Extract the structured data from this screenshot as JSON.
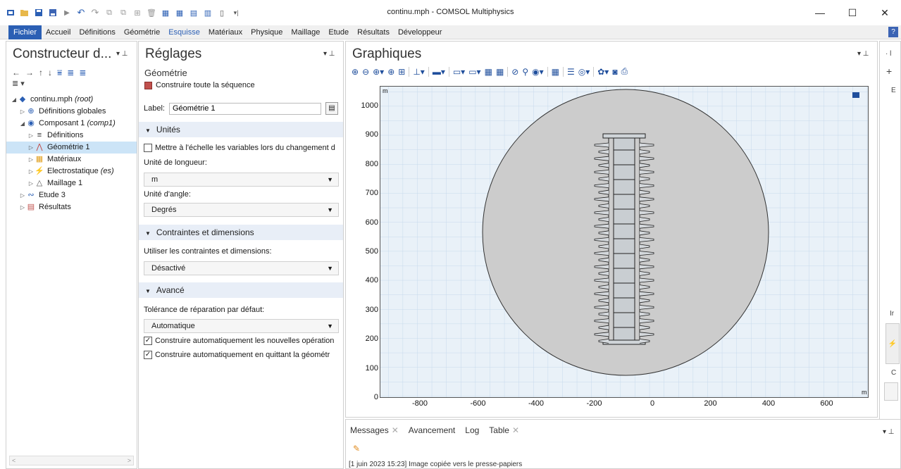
{
  "window": {
    "title": "continu.mph - COMSOL Multiphysics",
    "minimize": "—",
    "maximize": "☐",
    "close": "✕"
  },
  "menu": {
    "items": [
      "Fichier",
      "Accueil",
      "Définitions",
      "Géométrie",
      "Esquisse",
      "Matériaux",
      "Physique",
      "Maillage",
      "Etude",
      "Résultats",
      "Développeur"
    ],
    "help": "?"
  },
  "model_builder": {
    "title": "Constructeur d...",
    "toolbar": [
      "←",
      "→",
      "↑",
      "↓",
      "⩸",
      "≣",
      "≣"
    ],
    "toolbar2": "≣ ▾",
    "tree": [
      {
        "label": "continu.mph",
        "suffix": "(root)",
        "level": 0,
        "arrow": "◢",
        "icon": "root-icon"
      },
      {
        "label": "Définitions globales",
        "suffix": "",
        "level": 1,
        "arrow": "▷",
        "icon": "globe-icon"
      },
      {
        "label": "Composant 1",
        "suffix": "(comp1)",
        "level": 1,
        "arrow": "◢",
        "icon": "component-icon"
      },
      {
        "label": "Définitions",
        "suffix": "",
        "level": 2,
        "arrow": "▷",
        "icon": "definitions-icon"
      },
      {
        "label": "Géométrie 1",
        "suffix": "",
        "level": 2,
        "arrow": "▷",
        "icon": "geometry-icon",
        "selected": true
      },
      {
        "label": "Matériaux",
        "suffix": "",
        "level": 2,
        "arrow": "▷",
        "icon": "materials-icon"
      },
      {
        "label": "Electrostatique",
        "suffix": "(es)",
        "level": 2,
        "arrow": "▷",
        "icon": "electrostatics-icon"
      },
      {
        "label": "Maillage 1",
        "suffix": "",
        "level": 2,
        "arrow": "▷",
        "icon": "mesh-icon"
      },
      {
        "label": "Etude 3",
        "suffix": "",
        "level": 1,
        "arrow": "▷",
        "icon": "study-icon"
      },
      {
        "label": "Résultats",
        "suffix": "",
        "level": 1,
        "arrow": "▷",
        "icon": "results-icon"
      }
    ]
  },
  "settings": {
    "title": "Réglages",
    "subtitle": "Géométrie",
    "build_all": "Construire toute la séquence",
    "label_caption": "Label:",
    "label_value": "Géométrie 1",
    "sections": {
      "units": "Unités",
      "constraints": "Contraintes et dimensions",
      "advanced": "Avancé"
    },
    "scale_checkbox": "Mettre à l'échelle les variables lors du changement d",
    "length_unit_label": "Unité de longueur:",
    "length_unit_value": "m",
    "angle_unit_label": "Unité d'angle:",
    "angle_unit_value": "Degrés",
    "use_constraints_label": "Utiliser les contraintes et dimensions:",
    "use_constraints_value": "Désactivé",
    "repair_tolerance_label": "Tolérance de réparation par défaut:",
    "repair_tolerance_value": "Automatique",
    "auto_build_new": "Construire automatiquement les nouvelles opération",
    "auto_build_leave": "Construire automatiquement en quittant la géométr"
  },
  "graphics": {
    "title": "Graphiques",
    "y_ticks": [
      "1000",
      "900",
      "800",
      "700",
      "600",
      "500",
      "400",
      "300",
      "200",
      "100",
      "0"
    ],
    "x_ticks": [
      "-800",
      "-600",
      "-400",
      "-200",
      "0",
      "200",
      "400",
      "600"
    ],
    "axis_unit": "m"
  },
  "messages": {
    "tabs": [
      "Messages",
      "Avancement",
      "Log",
      "Table"
    ],
    "line": "[1 juin 2023 15:23] Image copiée vers le presse-papiers"
  },
  "right_strip": {
    "labels": [
      "E",
      "Ir",
      "C"
    ]
  }
}
